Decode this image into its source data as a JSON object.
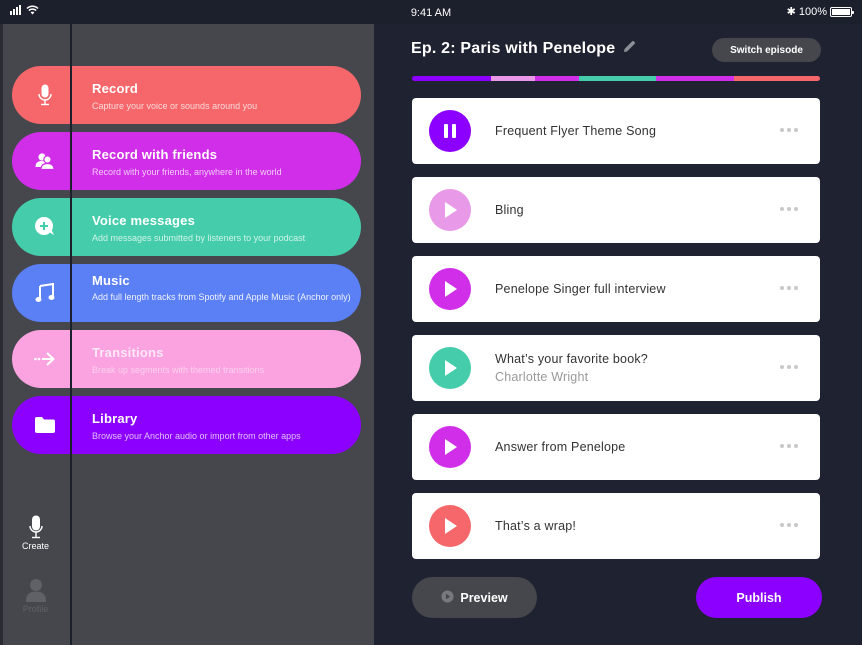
{
  "status_bar": {
    "time": "9:41 AM",
    "battery": "100%"
  },
  "menu": {
    "items": [
      {
        "title": "Record",
        "description": "Capture your voice or sounds around you",
        "icon": "microphone-icon",
        "color": "#f5676a"
      },
      {
        "title": "Record with friends",
        "description": "Record with your friends, anywhere in the world",
        "icon": "friends-icon",
        "color": "#d02ee8"
      },
      {
        "title": "Voice messages",
        "description": "Add messages submitted by listeners to your podcast",
        "icon": "voice-message-icon",
        "color": "#45cdab"
      },
      {
        "title": "Music",
        "description": "Add full length tracks from Spotify and Apple Music (Anchor only)",
        "icon": "music-note-icon",
        "color": "#5b7ff5"
      },
      {
        "title": "Transitions",
        "description": "Break up segments with themed transitions",
        "icon": "arrow-right-icon",
        "color": "#fba2e0"
      },
      {
        "title": "Library",
        "description": "Browse your Anchor audio or import from other apps",
        "icon": "folder-icon",
        "color": "#8b00ff"
      }
    ]
  },
  "rail": {
    "create_label": "Create",
    "profile_label": "Profile"
  },
  "episode": {
    "title": "Ep. 2: Paris with Penelope",
    "switch_label": "Switch episode",
    "progress_segments": [
      {
        "color": "#8b00ff",
        "fraction": 0.194
      },
      {
        "color": "#e89ae8",
        "fraction": 0.108
      },
      {
        "color": "#d02ee8",
        "fraction": 0.108
      },
      {
        "color": "#45cdab",
        "fraction": 0.189
      },
      {
        "color": "#d02ee8",
        "fraction": 0.191
      },
      {
        "color": "#f5676a",
        "fraction": 0.21
      }
    ]
  },
  "tracks": [
    {
      "title": "Frequent Flyer Theme Song",
      "subtitle": "",
      "state": "playing",
      "color": "#8b00ff"
    },
    {
      "title": "Bling",
      "subtitle": "",
      "state": "paused",
      "color": "#e89ae8"
    },
    {
      "title": "Penelope Singer full interview",
      "subtitle": "",
      "state": "paused",
      "color": "#d02ee8"
    },
    {
      "title": "What’s your favorite book?",
      "subtitle": "Charlotte Wright",
      "state": "paused",
      "color": "#45cdab"
    },
    {
      "title": "Answer from Penelope",
      "subtitle": "",
      "state": "paused",
      "color": "#d02ee8"
    },
    {
      "title": "That’s a wrap!",
      "subtitle": "",
      "state": "paused",
      "color": "#f5676a"
    }
  ],
  "actions": {
    "preview_label": "Preview",
    "publish_label": "Publish"
  }
}
